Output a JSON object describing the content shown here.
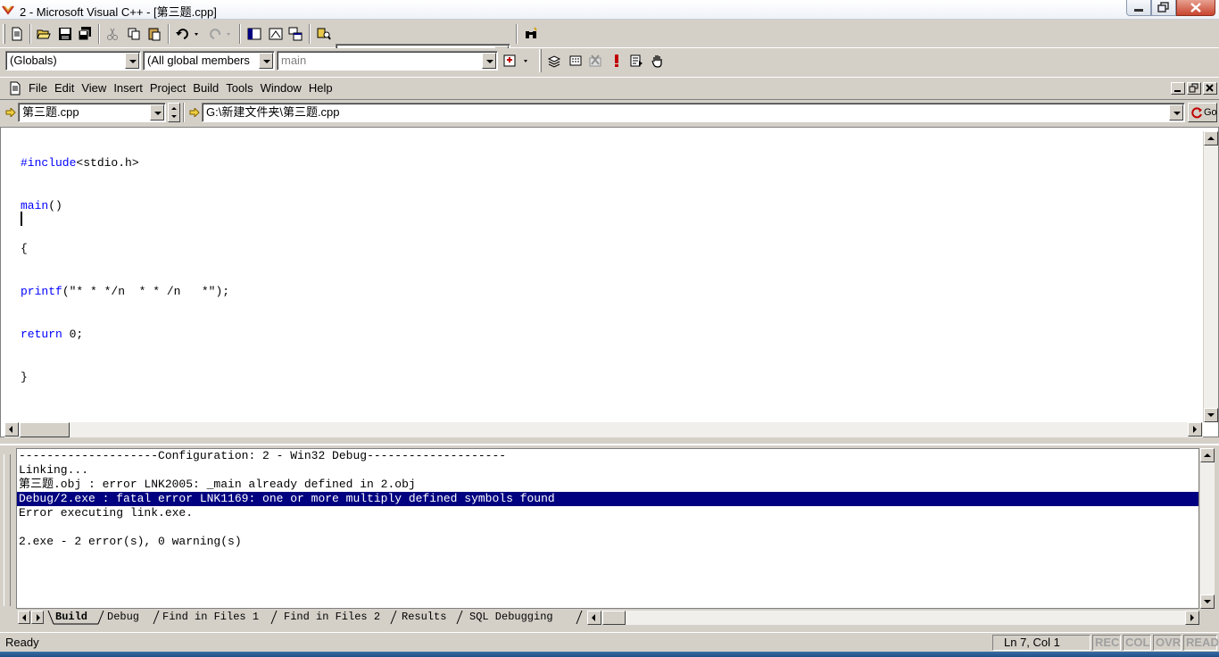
{
  "window": {
    "title": "2 - Microsoft Visual C++ - [第三题.cpp]",
    "icon": "visual-cpp-icon"
  },
  "toolbar": {
    "find_combo_value": "",
    "globals_combo": "(Globals)",
    "members_combo": "(All global members",
    "function_combo": "main"
  },
  "menu": {
    "items": [
      "File",
      "Edit",
      "View",
      "Insert",
      "Project",
      "Build",
      "Tools",
      "Window",
      "Help"
    ]
  },
  "wizardbar": {
    "file_combo": "第三题.cpp",
    "path_combo": "G:\\新建文件夹\\第三题.cpp",
    "go_label": "Go"
  },
  "editor": {
    "lines": [
      {
        "kw": "#include",
        "rest": "<stdio.h>"
      },
      {
        "kw": "main",
        "rest": "()"
      },
      {
        "kw": "",
        "rest": "{"
      },
      {
        "kw": "printf",
        "rest": "(\"* * */n  * * /n   *\");"
      },
      {
        "kw": "return",
        "rest": " 0;"
      },
      {
        "kw": "",
        "rest": "}"
      }
    ]
  },
  "output": {
    "lines": [
      "--------------------Configuration: 2 - Win32 Debug--------------------",
      "Linking...",
      "第三题.obj : error LNK2005: _main already defined in 2.obj",
      "Debug/2.exe : fatal error LNK1169: one or more multiply defined symbols found",
      "Error executing link.exe.",
      "",
      "2.exe - 2 error(s), 0 warning(s)"
    ],
    "selected_line": 3,
    "tabs": [
      "Build",
      "Debug",
      "Find in Files 1",
      "Find in Files 2",
      "Results",
      "SQL Debugging"
    ],
    "active_tab": "Build"
  },
  "status": {
    "text": "Ready",
    "position": "Ln 7, Col 1",
    "indicators": [
      "REC",
      "COL",
      "OVR",
      "READ"
    ]
  },
  "colors": {
    "selection": "#000080",
    "keyword": "#0000ff",
    "chrome": "#d4d0c8"
  }
}
